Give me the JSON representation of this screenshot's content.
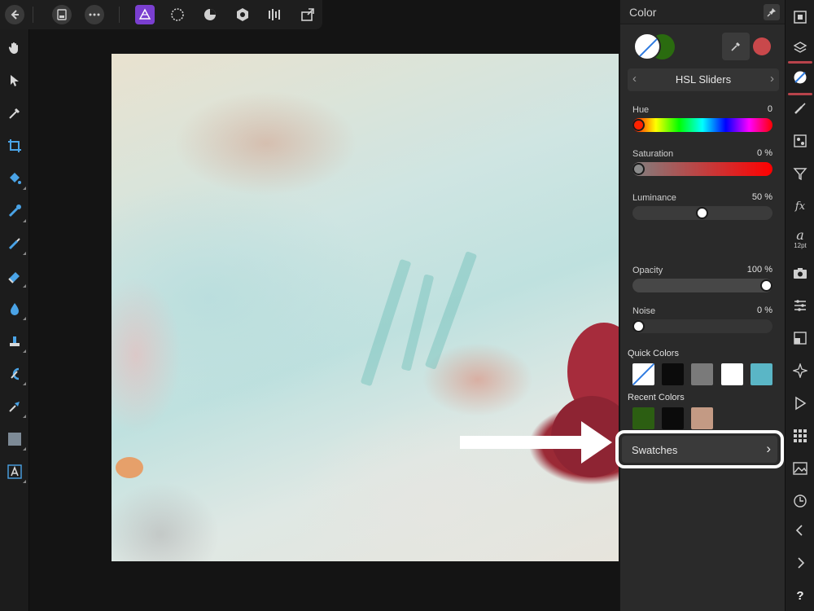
{
  "panel": {
    "title": "Color",
    "mode": "HSL Sliders",
    "sliders": [
      {
        "label": "Hue",
        "value": "0"
      },
      {
        "label": "Saturation",
        "value": "0 %"
      },
      {
        "label": "Luminance",
        "value": "50 %"
      },
      {
        "label": "Opacity",
        "value": "100 %"
      },
      {
        "label": "Noise",
        "value": "0 %"
      }
    ],
    "slider_levels": {
      "hue": 0,
      "saturation": 0,
      "luminance": 0.5,
      "opacity": 1.0,
      "noise": 0
    },
    "quick_colors_label": "Quick Colors",
    "recent_colors_label": "Recent Colors",
    "quick_colors": [
      "none",
      "#0b0b0b",
      "#7a7a7a",
      "#ffffff",
      "#5ab6c6"
    ],
    "recent_colors": [
      "#2c5e12",
      "#0b0b0b",
      "#c39a84"
    ],
    "swatches_label": "Swatches",
    "fill_color": "#2a6b0f",
    "picker_color": "#c9484b"
  },
  "icons": {
    "top": [
      "back-icon",
      "document-icon",
      "more-icon",
      "affinity-photo-persona-icon",
      "liquify-persona-icon",
      "develop-persona-icon",
      "tone-mapping-persona-icon",
      "export-persona-icon",
      "share-icon"
    ],
    "left": [
      "hand-tool-icon",
      "move-tool-icon",
      "color-picker-tool-icon",
      "crop-tool-icon",
      "flood-fill-tool-icon",
      "selection-brush-tool-icon",
      "paint-brush-tool-icon",
      "eraser-tool-icon",
      "dodge-tool-icon",
      "clone-tool-icon",
      "smudge-tool-icon",
      "pen-tool-icon",
      "rectangle-tool-icon",
      "text-tool-icon"
    ],
    "studio": [
      "navigator-icon",
      "layers-icon",
      "color-icon",
      "brushes-icon",
      "adjustments-icon",
      "filter-icon",
      "fx-icon",
      "text-style-icon",
      "camera-icon",
      "channels-icon",
      "transform-icon",
      "snap-icon",
      "play-icon",
      "grid-icon",
      "stock-icon",
      "history-icon",
      "chevron-left-icon",
      "chevron-right-icon",
      "help-icon"
    ]
  },
  "text_style_size": "12pt",
  "help_label": "?"
}
